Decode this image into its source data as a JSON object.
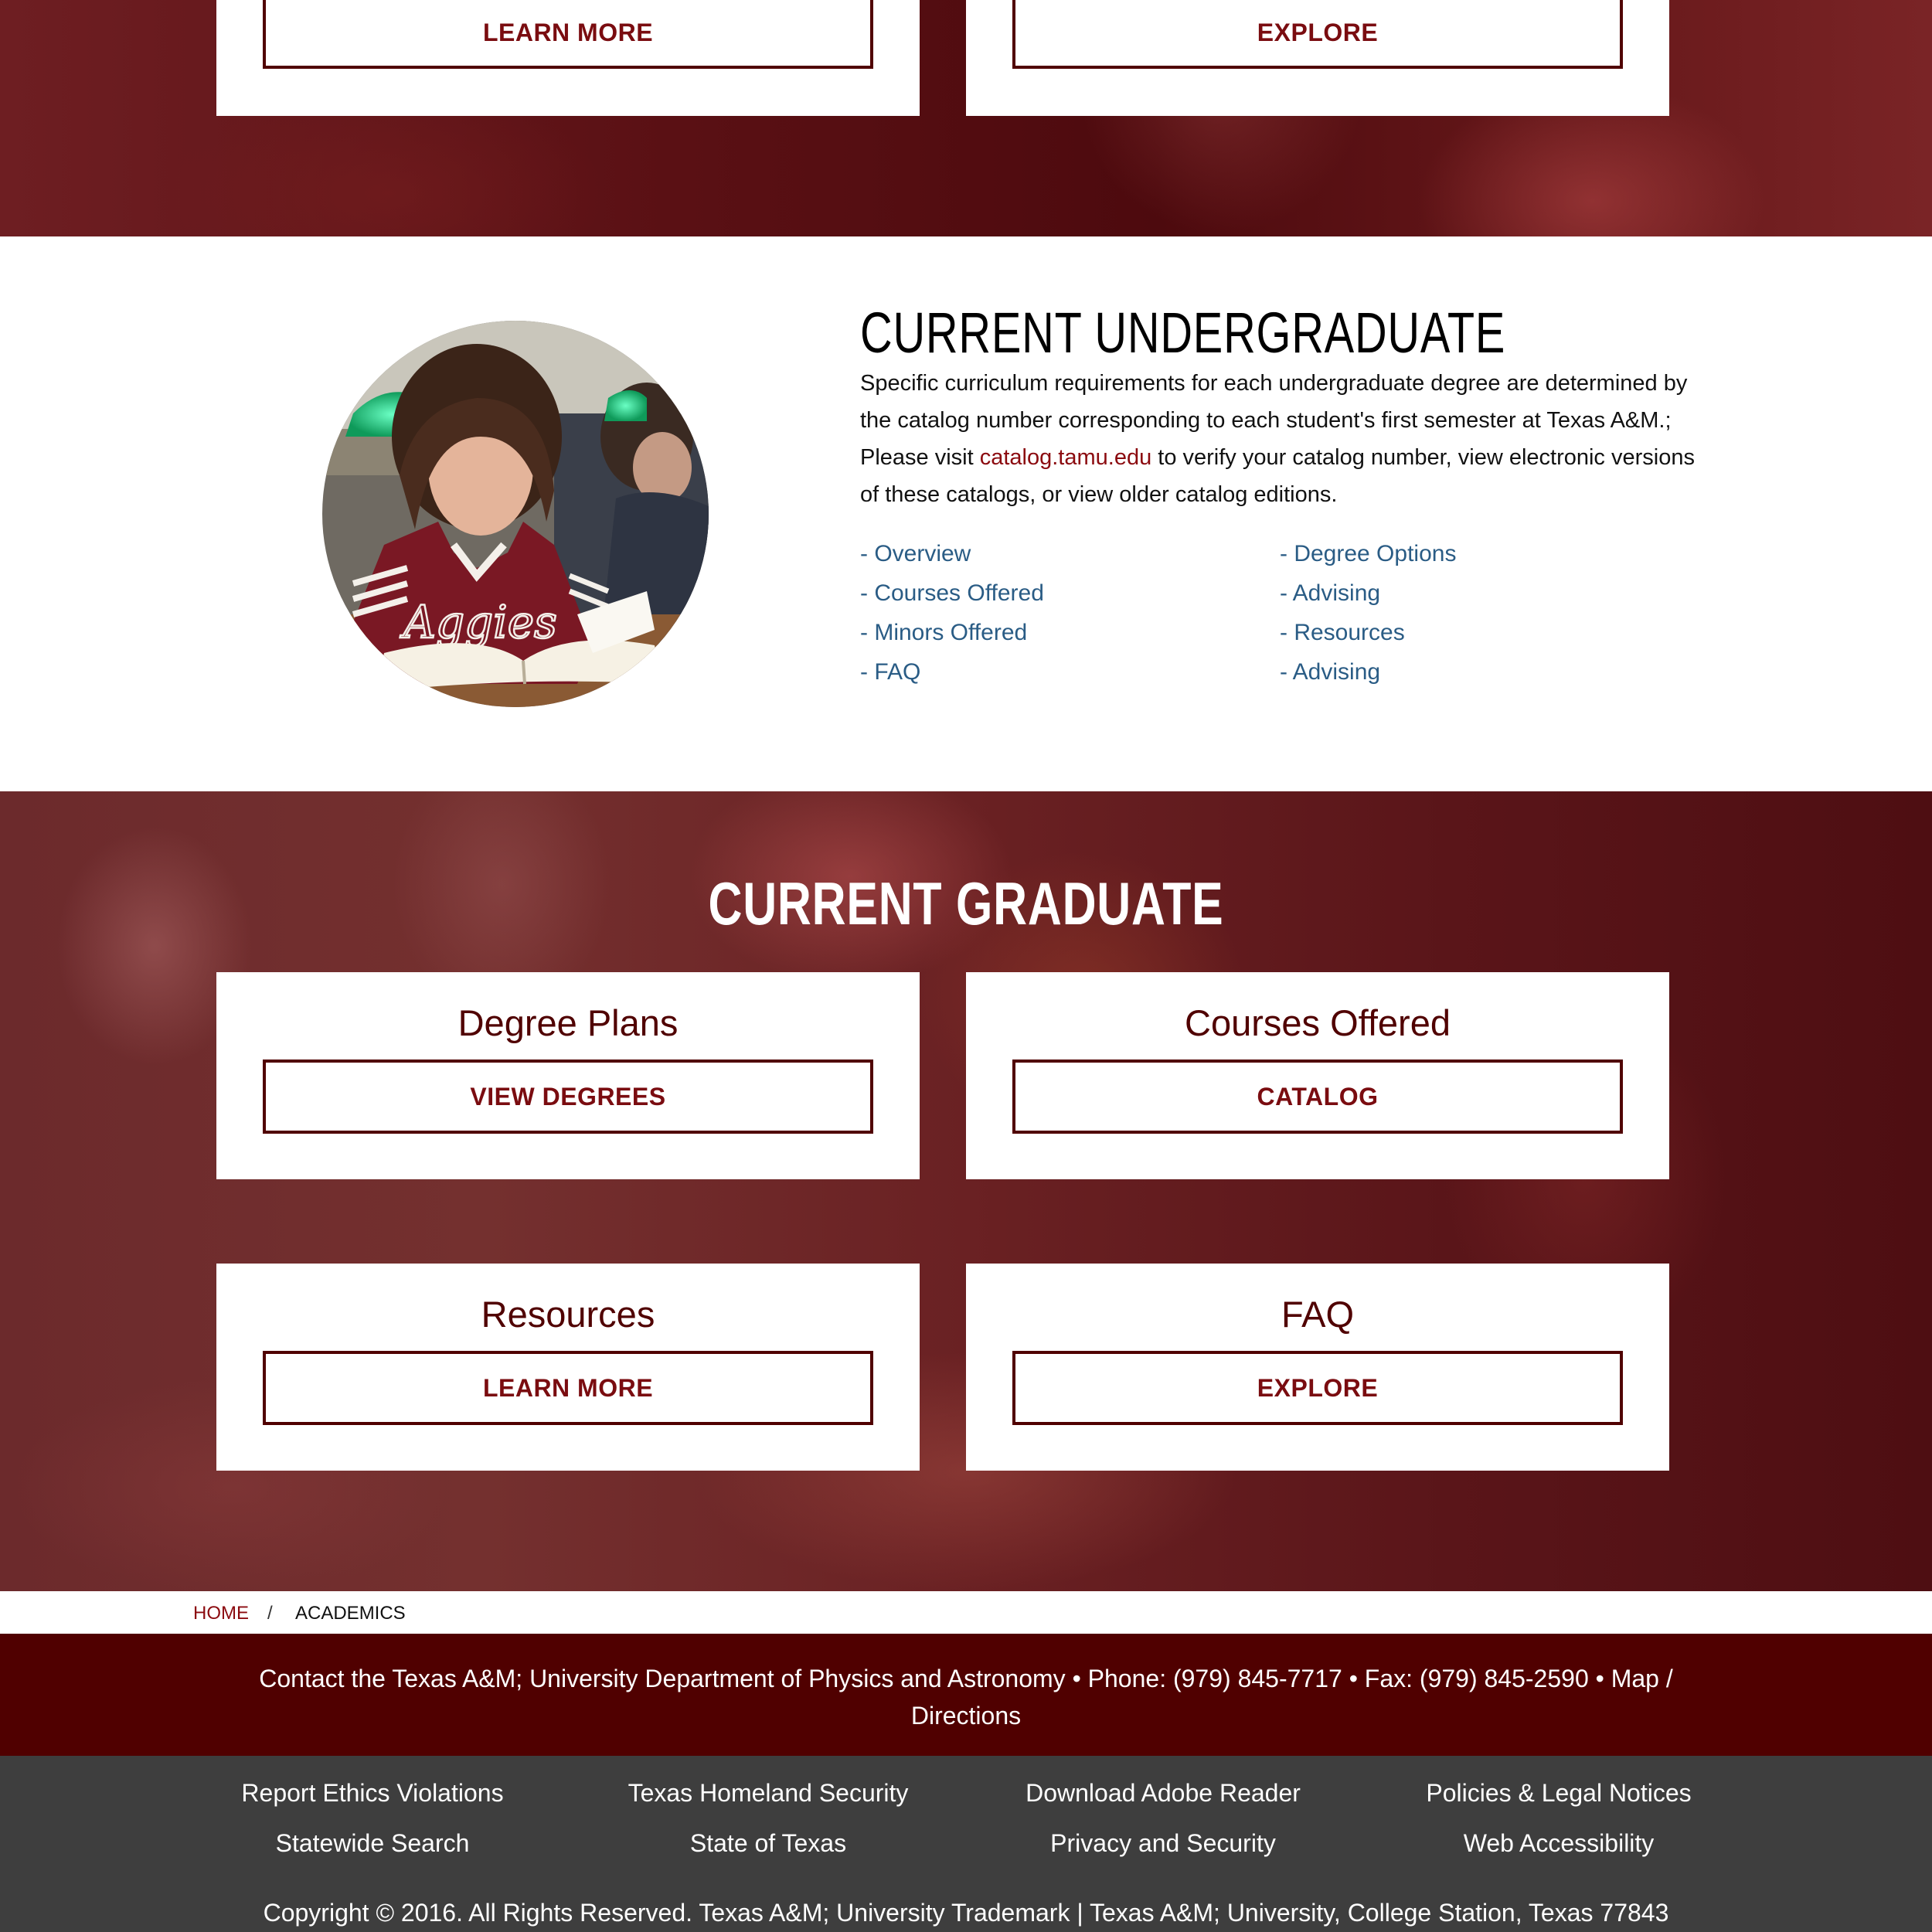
{
  "top_cards": [
    {
      "button": "LEARN MORE"
    },
    {
      "button": "EXPLORE"
    }
  ],
  "undergraduate": {
    "heading": "CURRENT UNDERGRADUATE",
    "text_before_link": "Specific curriculum requirements for each undergraduate degree are determined by the catalog number corresponding to each student's first semester at Texas A&M.; Please visit ",
    "link_text": "catalog.tamu.edu",
    "text_after_link": " to verify your catalog number, view electronic versions of these catalogs, or view older catalog editions.",
    "links_left": [
      "- Overview",
      "- Courses Offered",
      "- Minors Offered",
      "- FAQ"
    ],
    "links_right": [
      "- Degree Options",
      "- Advising",
      "- Resources",
      "- Advising"
    ],
    "photo_text": "Aggies"
  },
  "graduate": {
    "heading": "CURRENT GRADUATE",
    "cards": [
      {
        "title": "Degree Plans",
        "button": "VIEW DEGREES"
      },
      {
        "title": "Courses Offered",
        "button": "CATALOG"
      },
      {
        "title": "Resources",
        "button": "LEARN MORE"
      },
      {
        "title": "FAQ",
        "button": "EXPLORE"
      }
    ]
  },
  "breadcrumb": {
    "home": "HOME",
    "separator": "/",
    "current": "ACADEMICS"
  },
  "contact": "Contact the Texas A&M; University Department of Physics and Astronomy • Phone: (979) 845-7717 • Fax: (979) 845-2590 • Map / Directions",
  "footer": {
    "links_row1": [
      "Report Ethics Violations",
      "Texas Homeland Security",
      "Download Adobe Reader",
      "Policies & Legal Notices"
    ],
    "links_row2": [
      "Statewide Search",
      "State of Texas",
      "Privacy and Security",
      "Web Accessibility"
    ],
    "copyright": "Copyright © 2016. All Rights Reserved. Texas A&M; University Trademark | Texas A&M; University, College Station, Texas 77843"
  },
  "colors": {
    "maroon": "#500000",
    "link_red": "#8b0a0f",
    "link_blue": "#2a5c85",
    "footer_gray": "#3e3e3e"
  }
}
